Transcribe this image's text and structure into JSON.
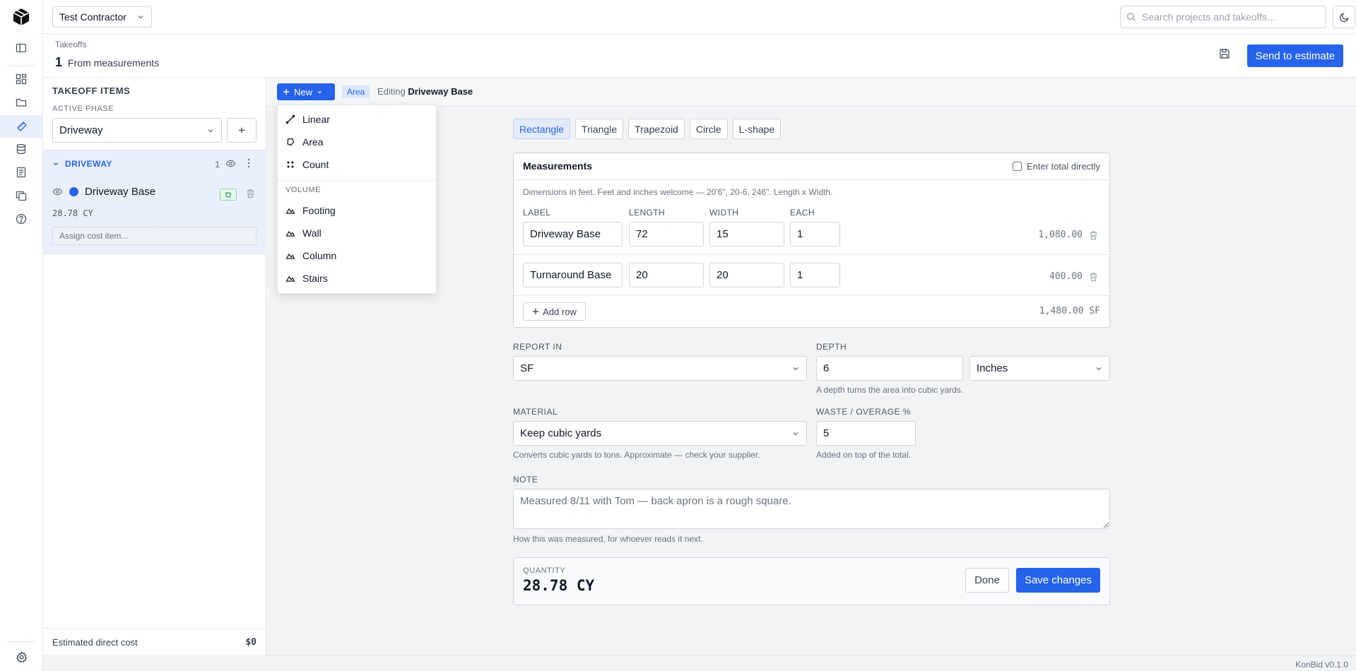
{
  "topbar": {
    "org_name": "Test Contractor",
    "search_placeholder": "Search projects and takeoffs..."
  },
  "header": {
    "breadcrumb": "Takeoffs",
    "title_number": "1",
    "title_sub": "From measurements",
    "send_label": "Send to estimate"
  },
  "sidebar": {
    "title": "TAKEOFF ITEMS",
    "phase_label": "ACTIVE PHASE",
    "phase_value": "Driveway",
    "add_label": "+",
    "group": {
      "name": "DRIVEWAY",
      "count": "1",
      "item": {
        "name": "Driveway Base",
        "quantity": "28.78 CY",
        "color": "#2563eb",
        "assign_label": "Assign cost item..."
      }
    },
    "footer_label": "Estimated direct cost",
    "footer_value": "$0"
  },
  "editor": {
    "new_label": "New",
    "type_badge": "Area",
    "editing_prefix": "Editing",
    "editing_name": "Driveway Base"
  },
  "dropdown": {
    "items": [
      "Linear",
      "Area",
      "Count"
    ],
    "section": "VOLUME",
    "volume_items": [
      "Footing",
      "Wall",
      "Column",
      "Stairs"
    ]
  },
  "shapes": [
    "Rectangle",
    "Triangle",
    "Trapezoid",
    "Circle",
    "L-shape"
  ],
  "measurements": {
    "title": "Measurements",
    "direct_label": "Enter total directly",
    "hint": "Dimensions in feet. Feet and inches welcome — 20'6\", 20-6, 246\". Length x Width.",
    "columns": [
      "LABEL",
      "LENGTH",
      "WIDTH",
      "EACH"
    ],
    "rows": [
      {
        "label": "Driveway Base",
        "length": "72",
        "width": "15",
        "each": "1",
        "total": "1,080.00"
      },
      {
        "label": "Turnaround Base",
        "length": "20",
        "width": "20",
        "each": "1",
        "total": "400.00"
      }
    ],
    "add_row_label": "Add row",
    "grand_total": "1,480.00 SF"
  },
  "form": {
    "report_label": "REPORT IN",
    "report_value": "SF",
    "depth_label": "DEPTH",
    "depth_value": "6",
    "depth_unit": "Inches",
    "depth_help": "A depth turns the area into cubic yards.",
    "material_label": "MATERIAL",
    "material_value": "Keep cubic yards",
    "material_help": "Converts cubic yards to tons. Approximate — check your supplier.",
    "waste_label": "WASTE / OVERAGE %",
    "waste_value": "5",
    "waste_help": "Added on top of the total.",
    "note_label": "NOTE",
    "note_placeholder": "Measured 8/11 with Tom — back apron is a rough square.",
    "note_help": "How this was measured, for whoever reads it next."
  },
  "quantity": {
    "label": "QUANTITY",
    "value": "28.78 CY",
    "done_label": "Done",
    "save_label": "Save changes"
  },
  "footer": {
    "version": "KonBid v0.1.0"
  },
  "colors": {
    "accent": "#2563eb",
    "active_bg": "#eaf0fb"
  }
}
